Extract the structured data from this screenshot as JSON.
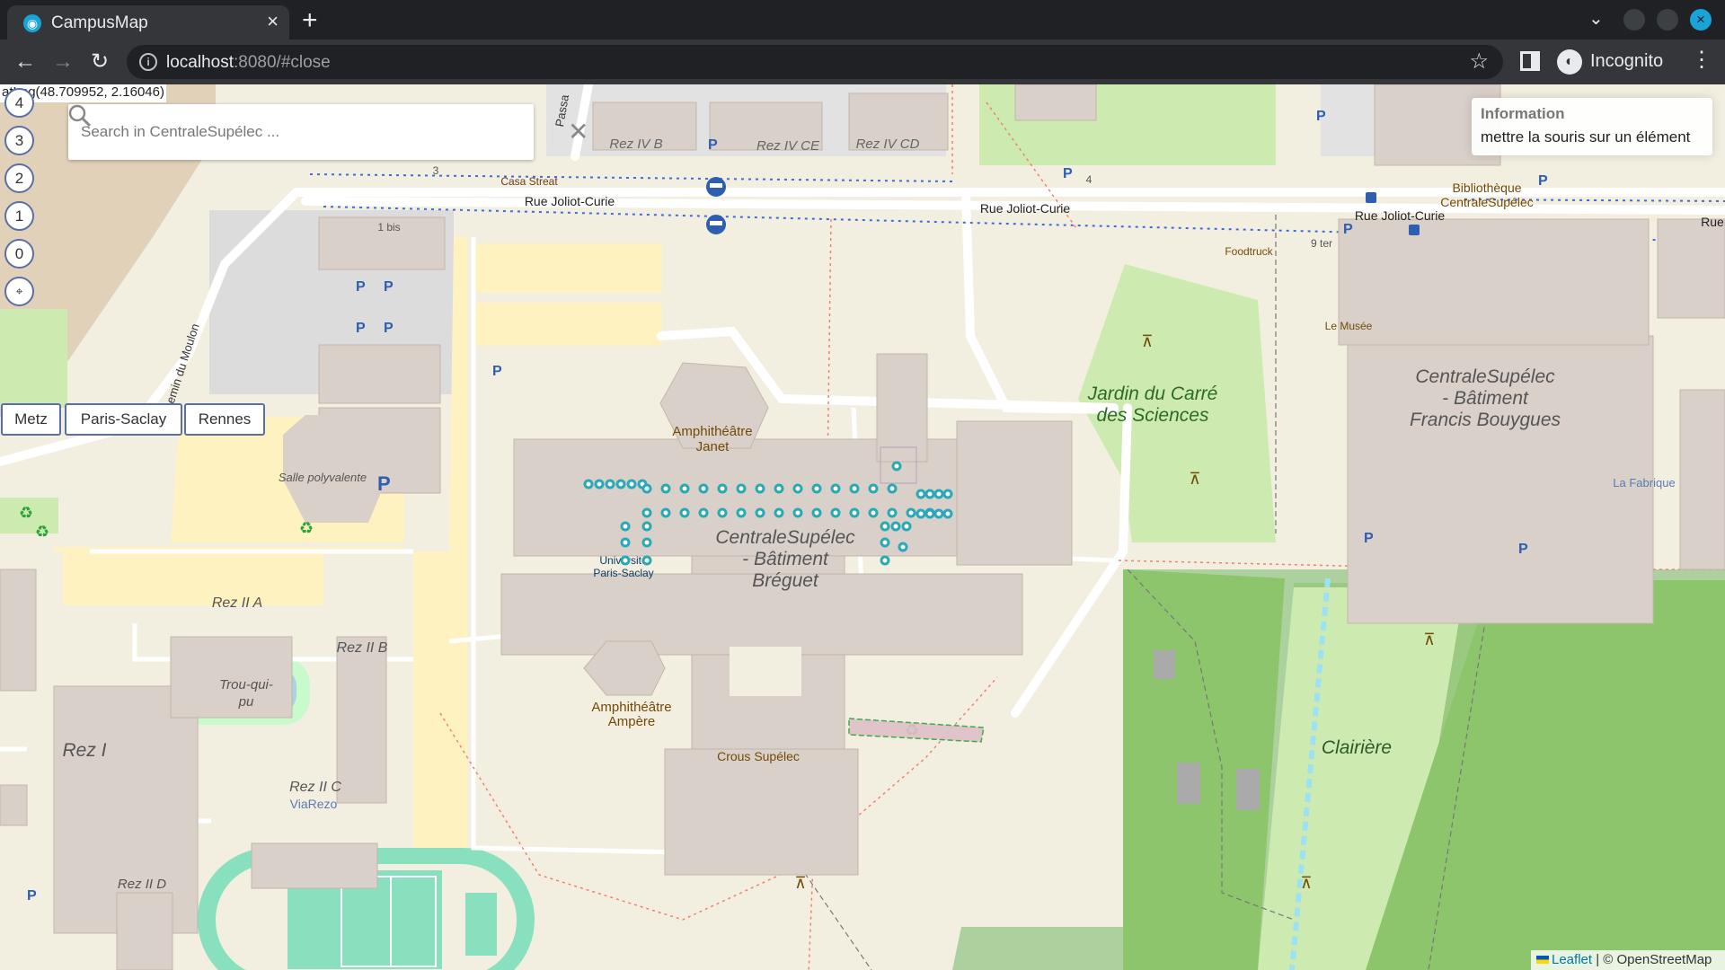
{
  "browser": {
    "tab_title": "CampusMap",
    "url_host": "localhost",
    "url_rest": ":8080/#close",
    "incognito_label": "Incognito"
  },
  "map": {
    "latlng_readout": "atLng(48.709952, 2.16046)",
    "search": {
      "placeholder": "Search in CentraleSupélec ..."
    },
    "floor_buttons": [
      "4",
      "3",
      "2",
      "1",
      "0",
      "⌖"
    ],
    "campus_buttons": [
      "Metz",
      "Paris-Saclay",
      "Rennes"
    ],
    "info_panel": {
      "title": "Information",
      "text": "mettre la souris sur un élément"
    },
    "attribution": {
      "leaflet": "Leaflet",
      "rest": " | © OpenStreetMap"
    },
    "labels": {
      "rez_iv_b": "Rez IV B",
      "rez_iv_ce": "Rez IV CE",
      "rez_iv_cd": "Rez IV CD",
      "casa_streat": "Casa Streat",
      "rue_joliot_curie": "Rue Joliot-Curie",
      "rue": "Rue",
      "num_3": "3",
      "num_1bis": "1 bis",
      "num_4": "4",
      "num_9ter": "9 ter",
      "bibliotheque_1": "Bibliothèque",
      "bibliotheque_2": "CentraleSupélec",
      "foodtruck": "Foodtruck",
      "le_musee": "Le Musée",
      "bouygues_1": "CentraleSupélec",
      "bouygues_2": "- Bâtiment",
      "bouygues_3": "Francis Bouygues",
      "jardin_1": "Jardin du Carré",
      "jardin_2": "des Sciences",
      "la_fabrique": "La Fabrique",
      "janet_1": "Amphithéâtre",
      "janet_2": "Janet",
      "breguet_1": "CentraleSupélec",
      "breguet_2": "- Bâtiment",
      "breguet_3": "Bréguet",
      "ups_1": "Université",
      "ups_2": "Paris-Saclay",
      "salle_poly": "Salle polyvalente",
      "rez_ii_a": "Rez II A",
      "rez_ii_b": "Rez II B",
      "rez_ii_c": "Rez II C",
      "rez_ii_d": "Rez II D",
      "viarezo": "ViaRezo",
      "rez_i": "Rez I",
      "trou_1": "Trou-qui-",
      "trou_2": "pu",
      "ampere_1": "Amphithéâtre",
      "ampere_2": "Ampère",
      "crous": "Crous Supélec",
      "clairiere": "Clairière",
      "chemin_moulon": "Chemin du Moulon",
      "passage": "Passa"
    },
    "colors": {
      "land": "#f2efe1",
      "building": "#d9d0c9",
      "road": "#ffffff",
      "parking": "#dddddd",
      "forest": "#8dc56c",
      "park": "#c8facc",
      "meadow": "#cdebb0",
      "pitch": "#88e0be"
    }
  }
}
